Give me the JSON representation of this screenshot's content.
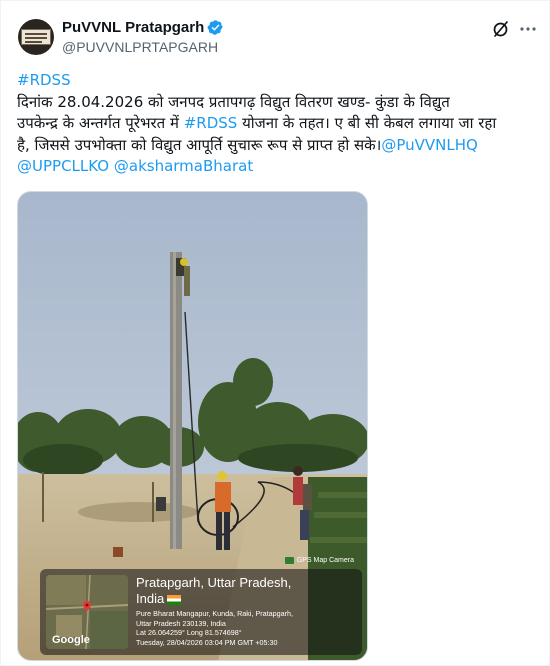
{
  "author": {
    "name": "PuVVNL Pratapgarh",
    "handle": "@PUVVNLPRTAPGARH",
    "verified_icon": "verified-badge-icon",
    "accent": "#1d9bf0"
  },
  "header_actions": {
    "grok_icon": "grok-icon",
    "more_icon": "more-options-icon"
  },
  "tweet": {
    "hashtag1": "#RDSS",
    "line1": "दिनांक 28.04.2026 को जनपद प्रतापगढ़ विद्युत वितरण खण्ड- कुंडा के विद्युत",
    "line2_a": "उपकेन्द्र के अन्तर्गत पूरेभरत  में ",
    "hashtag2": "#RDSS",
    "line2_b": " योजना के तहत। ए बी सी केबल लगाया जा रहा",
    "line3_a": "है, जिससे उपभोक्ता को विद्युत आपूर्ति सुचारू रूप से प्राप्त हो सके।",
    "mention1": "@PuVVNLHQ",
    "mention2": "@UPPCLLKO",
    "mention3": "@aksharmaBharat"
  },
  "media": {
    "gps_app": "GPS Map Camera",
    "place_line1": "Pratapgarh, Uttar Pradesh,",
    "place_line2": "India",
    "addr_line1": "Pure Bharat Mangapur, Kunda, Raki, Pratapgarh,",
    "addr_line2": "Uttar Pradesh 230139, India",
    "coords": "Lat 26.064259° Long 81.574698°",
    "datetime": "Tuesday, 28/04/2026 03:04 PM GMT +05:30",
    "map_brand": "Google"
  }
}
